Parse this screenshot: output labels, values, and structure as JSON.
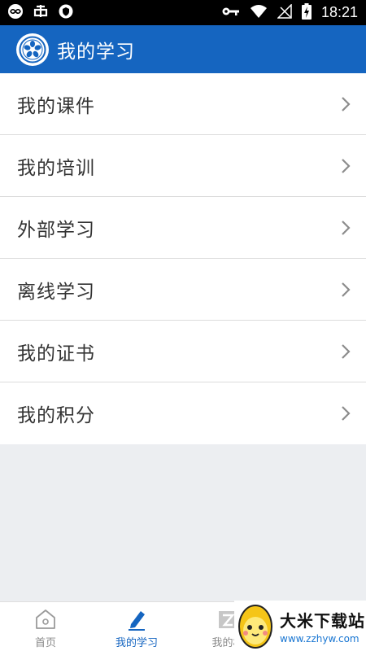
{
  "status_bar": {
    "time": "18:21",
    "icons": [
      "infinity-icon",
      "notification-icon",
      "shield-icon",
      "key-icon",
      "wifi-icon",
      "no-signal-icon",
      "battery-charging-icon"
    ]
  },
  "header": {
    "title": "我的学习",
    "logo": "emblem-logo"
  },
  "menu": {
    "items": [
      {
        "label": "我的课件"
      },
      {
        "label": "我的培训"
      },
      {
        "label": "外部学习"
      },
      {
        "label": "离线学习"
      },
      {
        "label": "我的证书"
      },
      {
        "label": "我的积分"
      }
    ]
  },
  "bottom_nav": {
    "items": [
      {
        "label": "首页",
        "icon": "home-icon"
      },
      {
        "label": "我的学习",
        "icon": "pen-icon",
        "active": true
      },
      {
        "label": "我的档",
        "icon": "profile-icon"
      }
    ]
  },
  "watermark": {
    "title": "大米下载站",
    "url": "www.zzhyw.com"
  },
  "colors": {
    "primary": "#1565c0",
    "background": "#eceef1",
    "status_bar": "#000000"
  }
}
